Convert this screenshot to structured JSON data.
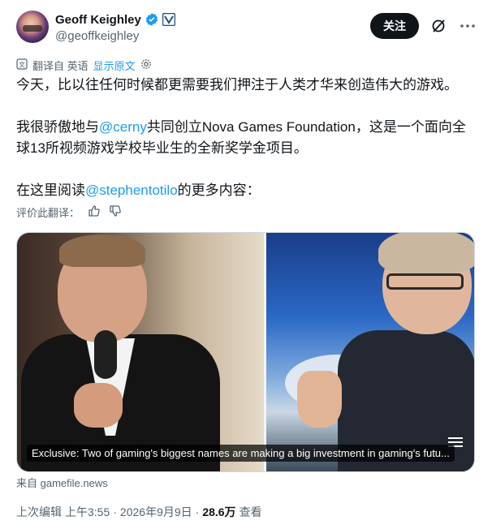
{
  "author": {
    "display_name": "Geoff Keighley",
    "handle": "@geoffkeighley"
  },
  "actions": {
    "follow_label": "关注"
  },
  "translate": {
    "info": "翻译自 英语",
    "show_original": "显示原文"
  },
  "tweet": {
    "line1": "今天，比以往任何时候都更需要我们押注于人类才华来创造伟大的游戏。",
    "line2_prefix": "我很骄傲地与",
    "line2_mention": "@cerny",
    "line2_suffix": "共同创立Nova Games Foundation，这是一个面向全球13所视频游戏学校毕业生的全新奖学金项目。",
    "line3_prefix": "在这里阅读",
    "line3_mention": "@stephentotilo",
    "line3_suffix": "的更多内容："
  },
  "rate": {
    "label": "评价此翻译："
  },
  "card": {
    "caption": "Exclusive: Two of gaming's biggest names are making a big investment in gaming's futu..."
  },
  "source": {
    "text": "来自 gamefile.news"
  },
  "meta": {
    "edited": "上次编辑",
    "time": "上午3:55",
    "dot1": "·",
    "date": "2026年9月9日",
    "dot2": "·",
    "views_count": "28.6万",
    "views_label": "查看"
  },
  "colors": {
    "accent": "#1d9bf0",
    "text": "#0f1419",
    "secondary": "#536471"
  }
}
